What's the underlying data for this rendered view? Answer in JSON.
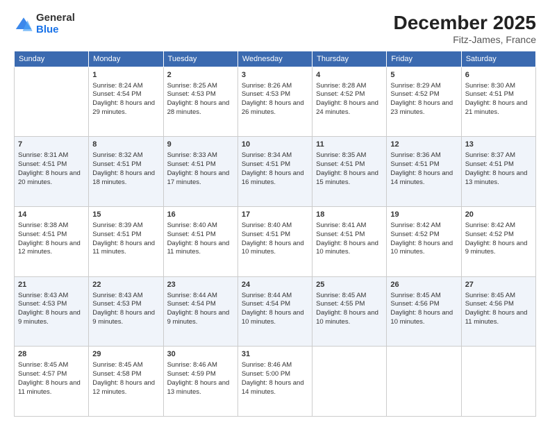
{
  "logo": {
    "general": "General",
    "blue": "Blue"
  },
  "title": {
    "month": "December 2025",
    "location": "Fitz-James, France"
  },
  "days": [
    "Sunday",
    "Monday",
    "Tuesday",
    "Wednesday",
    "Thursday",
    "Friday",
    "Saturday"
  ],
  "weeks": [
    [
      {
        "day": "",
        "sunrise": "",
        "sunset": "",
        "daylight": ""
      },
      {
        "day": "1",
        "sunrise": "Sunrise: 8:24 AM",
        "sunset": "Sunset: 4:54 PM",
        "daylight": "Daylight: 8 hours and 29 minutes."
      },
      {
        "day": "2",
        "sunrise": "Sunrise: 8:25 AM",
        "sunset": "Sunset: 4:53 PM",
        "daylight": "Daylight: 8 hours and 28 minutes."
      },
      {
        "day": "3",
        "sunrise": "Sunrise: 8:26 AM",
        "sunset": "Sunset: 4:53 PM",
        "daylight": "Daylight: 8 hours and 26 minutes."
      },
      {
        "day": "4",
        "sunrise": "Sunrise: 8:28 AM",
        "sunset": "Sunset: 4:52 PM",
        "daylight": "Daylight: 8 hours and 24 minutes."
      },
      {
        "day": "5",
        "sunrise": "Sunrise: 8:29 AM",
        "sunset": "Sunset: 4:52 PM",
        "daylight": "Daylight: 8 hours and 23 minutes."
      },
      {
        "day": "6",
        "sunrise": "Sunrise: 8:30 AM",
        "sunset": "Sunset: 4:51 PM",
        "daylight": "Daylight: 8 hours and 21 minutes."
      }
    ],
    [
      {
        "day": "7",
        "sunrise": "Sunrise: 8:31 AM",
        "sunset": "Sunset: 4:51 PM",
        "daylight": "Daylight: 8 hours and 20 minutes."
      },
      {
        "day": "8",
        "sunrise": "Sunrise: 8:32 AM",
        "sunset": "Sunset: 4:51 PM",
        "daylight": "Daylight: 8 hours and 18 minutes."
      },
      {
        "day": "9",
        "sunrise": "Sunrise: 8:33 AM",
        "sunset": "Sunset: 4:51 PM",
        "daylight": "Daylight: 8 hours and 17 minutes."
      },
      {
        "day": "10",
        "sunrise": "Sunrise: 8:34 AM",
        "sunset": "Sunset: 4:51 PM",
        "daylight": "Daylight: 8 hours and 16 minutes."
      },
      {
        "day": "11",
        "sunrise": "Sunrise: 8:35 AM",
        "sunset": "Sunset: 4:51 PM",
        "daylight": "Daylight: 8 hours and 15 minutes."
      },
      {
        "day": "12",
        "sunrise": "Sunrise: 8:36 AM",
        "sunset": "Sunset: 4:51 PM",
        "daylight": "Daylight: 8 hours and 14 minutes."
      },
      {
        "day": "13",
        "sunrise": "Sunrise: 8:37 AM",
        "sunset": "Sunset: 4:51 PM",
        "daylight": "Daylight: 8 hours and 13 minutes."
      }
    ],
    [
      {
        "day": "14",
        "sunrise": "Sunrise: 8:38 AM",
        "sunset": "Sunset: 4:51 PM",
        "daylight": "Daylight: 8 hours and 12 minutes."
      },
      {
        "day": "15",
        "sunrise": "Sunrise: 8:39 AM",
        "sunset": "Sunset: 4:51 PM",
        "daylight": "Daylight: 8 hours and 11 minutes."
      },
      {
        "day": "16",
        "sunrise": "Sunrise: 8:40 AM",
        "sunset": "Sunset: 4:51 PM",
        "daylight": "Daylight: 8 hours and 11 minutes."
      },
      {
        "day": "17",
        "sunrise": "Sunrise: 8:40 AM",
        "sunset": "Sunset: 4:51 PM",
        "daylight": "Daylight: 8 hours and 10 minutes."
      },
      {
        "day": "18",
        "sunrise": "Sunrise: 8:41 AM",
        "sunset": "Sunset: 4:51 PM",
        "daylight": "Daylight: 8 hours and 10 minutes."
      },
      {
        "day": "19",
        "sunrise": "Sunrise: 8:42 AM",
        "sunset": "Sunset: 4:52 PM",
        "daylight": "Daylight: 8 hours and 10 minutes."
      },
      {
        "day": "20",
        "sunrise": "Sunrise: 8:42 AM",
        "sunset": "Sunset: 4:52 PM",
        "daylight": "Daylight: 8 hours and 9 minutes."
      }
    ],
    [
      {
        "day": "21",
        "sunrise": "Sunrise: 8:43 AM",
        "sunset": "Sunset: 4:53 PM",
        "daylight": "Daylight: 8 hours and 9 minutes."
      },
      {
        "day": "22",
        "sunrise": "Sunrise: 8:43 AM",
        "sunset": "Sunset: 4:53 PM",
        "daylight": "Daylight: 8 hours and 9 minutes."
      },
      {
        "day": "23",
        "sunrise": "Sunrise: 8:44 AM",
        "sunset": "Sunset: 4:54 PM",
        "daylight": "Daylight: 8 hours and 9 minutes."
      },
      {
        "day": "24",
        "sunrise": "Sunrise: 8:44 AM",
        "sunset": "Sunset: 4:54 PM",
        "daylight": "Daylight: 8 hours and 10 minutes."
      },
      {
        "day": "25",
        "sunrise": "Sunrise: 8:45 AM",
        "sunset": "Sunset: 4:55 PM",
        "daylight": "Daylight: 8 hours and 10 minutes."
      },
      {
        "day": "26",
        "sunrise": "Sunrise: 8:45 AM",
        "sunset": "Sunset: 4:56 PM",
        "daylight": "Daylight: 8 hours and 10 minutes."
      },
      {
        "day": "27",
        "sunrise": "Sunrise: 8:45 AM",
        "sunset": "Sunset: 4:56 PM",
        "daylight": "Daylight: 8 hours and 11 minutes."
      }
    ],
    [
      {
        "day": "28",
        "sunrise": "Sunrise: 8:45 AM",
        "sunset": "Sunset: 4:57 PM",
        "daylight": "Daylight: 8 hours and 11 minutes."
      },
      {
        "day": "29",
        "sunrise": "Sunrise: 8:45 AM",
        "sunset": "Sunset: 4:58 PM",
        "daylight": "Daylight: 8 hours and 12 minutes."
      },
      {
        "day": "30",
        "sunrise": "Sunrise: 8:46 AM",
        "sunset": "Sunset: 4:59 PM",
        "daylight": "Daylight: 8 hours and 13 minutes."
      },
      {
        "day": "31",
        "sunrise": "Sunrise: 8:46 AM",
        "sunset": "Sunset: 5:00 PM",
        "daylight": "Daylight: 8 hours and 14 minutes."
      },
      {
        "day": "",
        "sunrise": "",
        "sunset": "",
        "daylight": ""
      },
      {
        "day": "",
        "sunrise": "",
        "sunset": "",
        "daylight": ""
      },
      {
        "day": "",
        "sunrise": "",
        "sunset": "",
        "daylight": ""
      }
    ]
  ]
}
